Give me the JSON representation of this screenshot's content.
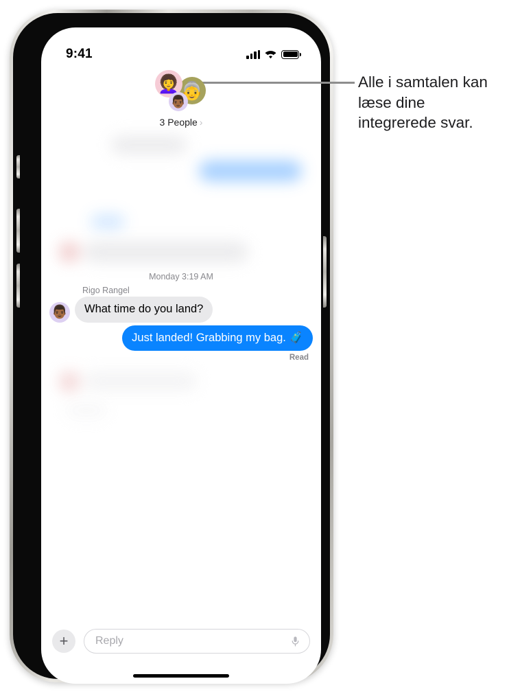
{
  "status_bar": {
    "time": "9:41",
    "cellular_icon": "cellular-signal-icon",
    "wifi_icon": "wifi-icon",
    "battery_icon": "battery-full-icon"
  },
  "conversation_header": {
    "participants_label": "3 People",
    "chevron": "›",
    "avatars": [
      {
        "name": "memoji-pink-avatar",
        "glyph": "👩‍🦱",
        "background": "#f6ccd6"
      },
      {
        "name": "photo-avatar",
        "glyph": "👵",
        "background": "#a6a25c"
      },
      {
        "name": "memoji-lavender-avatar",
        "glyph": "👨🏾",
        "background": "#ddd0f2"
      }
    ]
  },
  "thread": {
    "timestamp": "Monday 3:19 AM",
    "sender_name": "Rigo Rangel",
    "incoming_message": "What time do you land?",
    "incoming_avatar_glyph": "👨🏾",
    "outgoing_message": "Just landed! Grabbing my bag. 🧳",
    "read_receipt": "Read",
    "bubble_colors": {
      "incoming": "#e9e9eb",
      "outgoing": "#0a84ff"
    }
  },
  "input_bar": {
    "add_label": "+",
    "reply_placeholder": "Reply",
    "mic_icon": "microphone-icon"
  },
  "callout": {
    "text": "Alle i samtalen kan læse dine integrerede svar."
  }
}
